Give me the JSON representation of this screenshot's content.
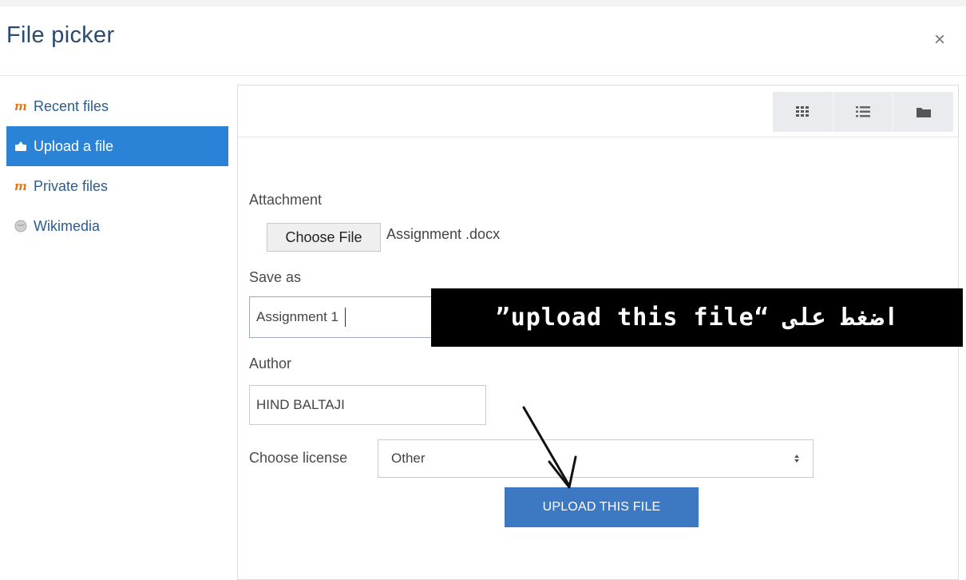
{
  "dialog": {
    "title": "File picker",
    "close_glyph": "×"
  },
  "sidebar": {
    "items": [
      {
        "label": "Recent files",
        "icon": "moodle-repo-icon",
        "active": false
      },
      {
        "label": "Upload a file",
        "icon": "upload-icon",
        "active": true
      },
      {
        "label": "Private files",
        "icon": "moodle-repo-icon",
        "active": false
      },
      {
        "label": "Wikimedia",
        "icon": "wikimedia-icon",
        "active": false
      }
    ]
  },
  "toolbar": {
    "views": [
      "grid-view-icon",
      "list-view-icon",
      "folder-view-icon"
    ]
  },
  "form": {
    "attachment_label": "Attachment",
    "choose_file_label": "Choose File",
    "file_name": "Assignment .docx",
    "save_as_label": "Save as",
    "save_as_value": "Assignment 1",
    "author_label": "Author",
    "author_value": "HIND BALTAJI",
    "license_label": "Choose license",
    "license_value": "Other",
    "upload_button": "UPLOAD THIS FILE"
  },
  "annotation": {
    "text": "اضغط على “upload this file”"
  },
  "colors": {
    "title": "#2a4a6e",
    "active_item": "#2b83d8",
    "upload_button": "#3d78c2",
    "callout_bg": "#000000"
  }
}
